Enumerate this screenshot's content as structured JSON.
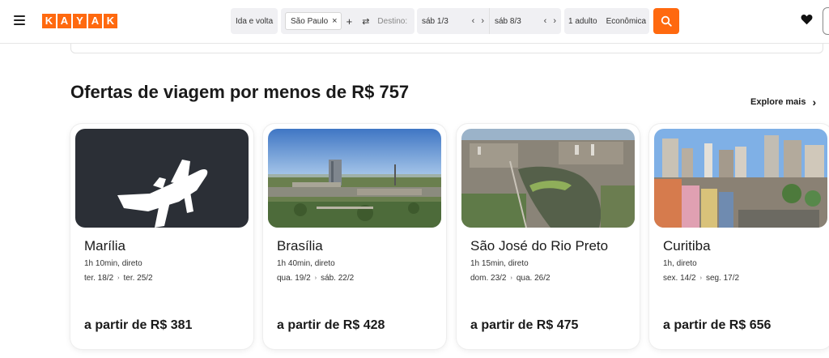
{
  "header": {
    "logo_letters": [
      "K",
      "A",
      "Y",
      "A",
      "K"
    ],
    "trip_type": "Ida e volta",
    "origin": "São Paulo",
    "origin_remove": "×",
    "add_origin": "+",
    "swap": "⇄",
    "destination_placeholder": "Destino:",
    "depart_date": "sáb 1/3",
    "return_date": "sáb 8/3",
    "prev_arrow": "‹",
    "next_arrow": "›",
    "travelers": "1 adulto",
    "cabin": "Econômica",
    "brand_color": "#ff690f"
  },
  "section": {
    "title": "Ofertas de viagem por menos de R$ 757",
    "explore_label": "Explore mais",
    "explore_chevron": "›"
  },
  "deals": [
    {
      "city": "Marília",
      "duration": "1h 10min, direto",
      "depart": "ter. 18/2",
      "return": "ter. 25/2",
      "price": "a partir de R$ 381",
      "sep": "›",
      "image": "plane-placeholder"
    },
    {
      "city": "Brasília",
      "duration": "1h 40min, direto",
      "depart": "qua. 19/2",
      "return": "sáb. 22/2",
      "price": "a partir de R$ 428",
      "sep": "›",
      "image": "brasilia-photo"
    },
    {
      "city": "São José do Rio Preto",
      "duration": "1h 15min, direto",
      "depart": "dom. 23/2",
      "return": "qua. 26/2",
      "price": "a partir de R$ 475",
      "sep": "›",
      "image": "lake-city-photo"
    },
    {
      "city": "Curitiba",
      "duration": "1h, direto",
      "depart": "sex. 14/2",
      "return": "seg. 17/2",
      "price": "a partir de R$ 656",
      "sep": "›",
      "image": "curitiba-photo"
    }
  ]
}
